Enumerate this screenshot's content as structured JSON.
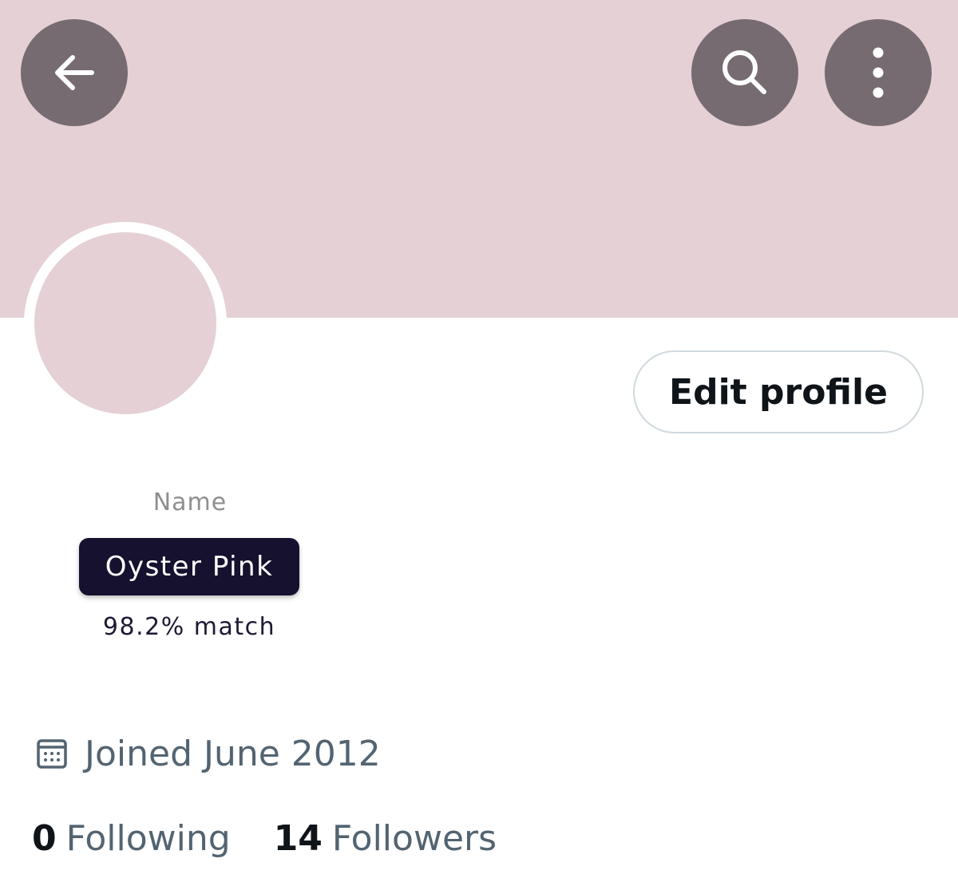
{
  "header": {
    "back_icon": "arrow-left-icon",
    "search_icon": "search-icon",
    "more_icon": "more-vertical-icon",
    "banner_color": "#e4d0d5",
    "button_color": "#766b70"
  },
  "profile": {
    "avatar_color": "#e4d0d5",
    "edit_button_label": "Edit profile",
    "name_label": "Name",
    "name_value": "Oyster Pink",
    "match_text": "98.2% match",
    "calendar_icon": "calendar-icon",
    "joined_text": "Joined June 2012"
  },
  "stats": {
    "following_count": "0",
    "following_label": "Following",
    "followers_count": "14",
    "followers_label": "Followers"
  }
}
